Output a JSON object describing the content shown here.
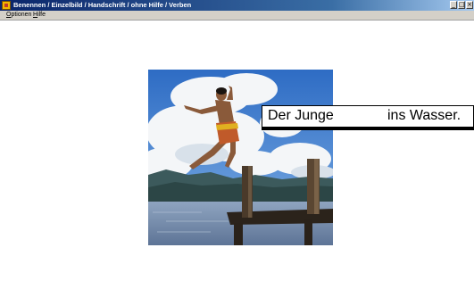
{
  "window": {
    "title": "Benennen / Einzelbild / Handschrift / ohne Hilfe / Verben",
    "app_icon": "app-icon",
    "buttons": [
      "minimize-icon",
      "maximize-icon",
      "close-icon"
    ]
  },
  "menu": {
    "items": [
      {
        "label_underlined": "O",
        "label_rest": "ptionen"
      },
      {
        "label_underlined": "H",
        "label_rest": "ilfe"
      }
    ]
  },
  "exercise": {
    "image": "boy-jumping-into-lake-photo",
    "sentence_start": "Der Junge",
    "sentence_end": "ins Wasser.",
    "colors": {
      "sky": "#3f7fd0",
      "water": "#7e95b5",
      "dock": "#3a2e22"
    }
  }
}
